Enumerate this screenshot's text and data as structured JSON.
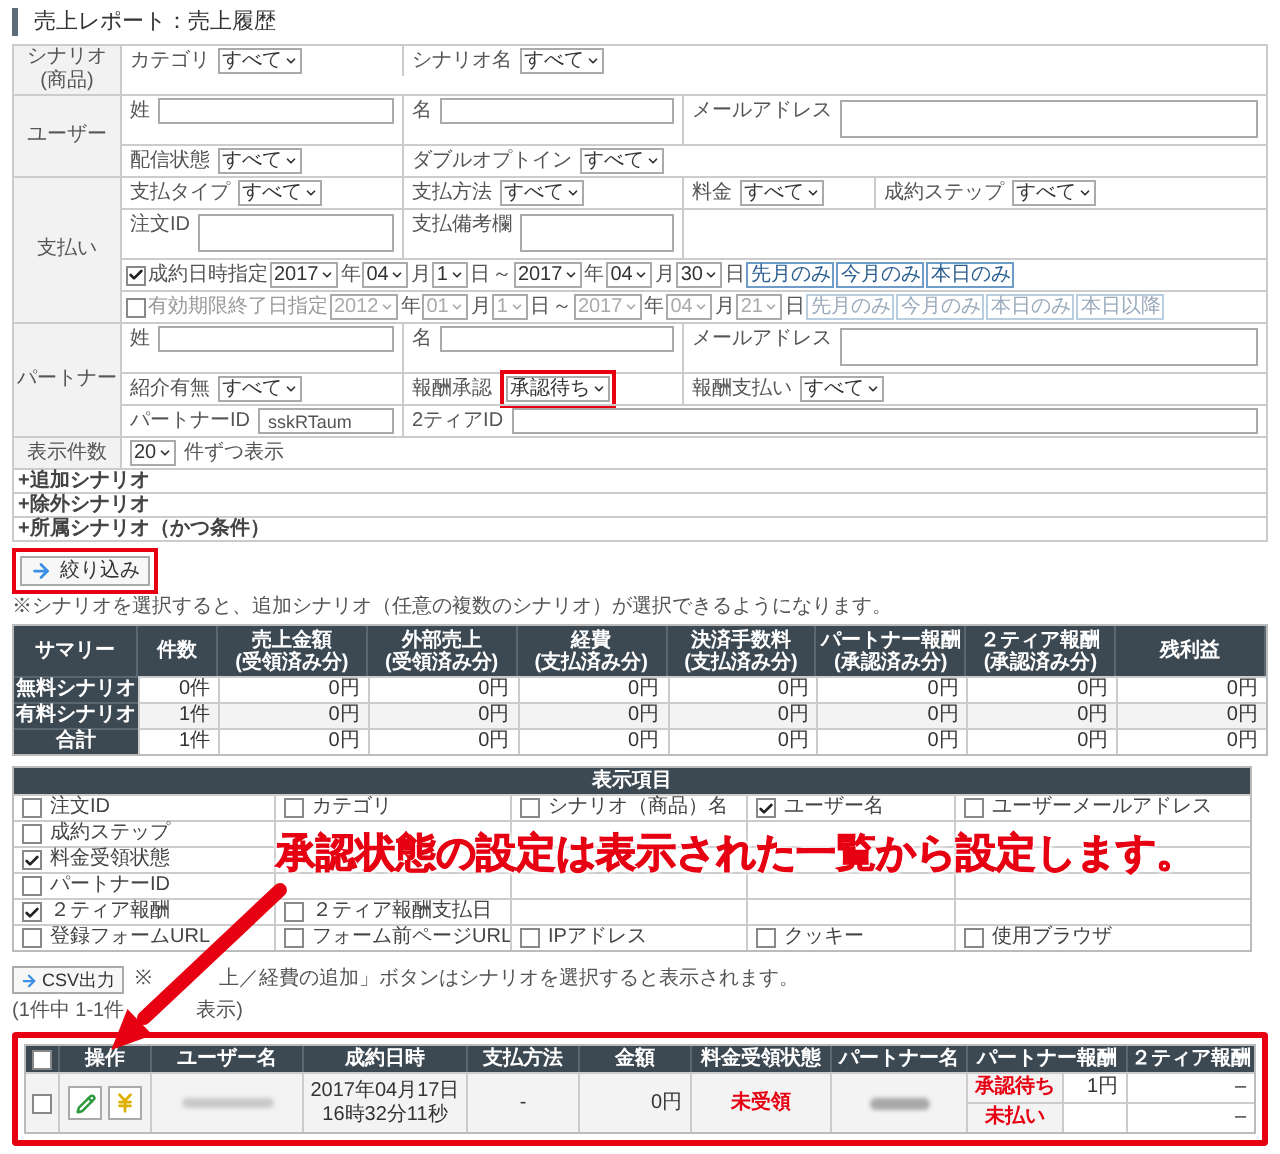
{
  "title": "売上レポート：売上履歴",
  "filter": {
    "sections": [
      {
        "label": [
          "シナリオ",
          "(商品)"
        ],
        "rows": [
          [
            {
              "kind": "select",
              "label": "カテゴリ",
              "value": "すべて"
            },
            {
              "kind": "select",
              "label": "シナリオ名",
              "value": "すべて"
            }
          ]
        ]
      },
      {
        "label": [
          "ユーザー"
        ],
        "rows": [
          [
            {
              "kind": "text",
              "label": "姓"
            },
            {
              "kind": "text",
              "label": "名"
            },
            {
              "kind": "textarea",
              "label": "メールアドレス"
            }
          ],
          [
            {
              "kind": "select",
              "label": "配信状態",
              "value": "すべて"
            },
            {
              "kind": "select",
              "label": "ダブルオプトイン",
              "value": "すべて"
            }
          ]
        ]
      },
      {
        "label": [
          "支払い"
        ],
        "rows": [
          [
            {
              "kind": "select",
              "label": "支払タイプ",
              "value": "すべて"
            },
            {
              "kind": "select",
              "label": "支払方法",
              "value": "すべて"
            },
            {
              "kind": "select",
              "label": "料金",
              "value": "すべて"
            },
            {
              "kind": "select",
              "label": "成約ステップ",
              "value": "すべて"
            }
          ],
          [
            {
              "kind": "textarea",
              "label": "注文ID"
            },
            {
              "kind": "textarea",
              "label": "支払備考欄"
            },
            {
              "kind": "empty"
            }
          ],
          [
            {
              "kind": "date_range",
              "checked": true,
              "label": "成約日時指定",
              "from": [
                {
                  "value": "2017",
                  "unit": "年"
                },
                {
                  "value": "04",
                  "unit": "月"
                },
                {
                  "value": "1",
                  "unit": "日"
                }
              ],
              "separator": "～",
              "to": [
                {
                  "value": "2017",
                  "unit": "年"
                },
                {
                  "value": "04",
                  "unit": "月"
                },
                {
                  "value": "30",
                  "unit": "日"
                }
              ],
              "buttons": [
                "先月のみ",
                "今月のみ",
                "本日のみ"
              ]
            }
          ],
          [
            {
              "kind": "date_range",
              "checked": false,
              "label": "有効期限終了日指定",
              "from": [
                {
                  "value": "2012",
                  "unit": "年"
                },
                {
                  "value": "01",
                  "unit": "月"
                },
                {
                  "value": "1",
                  "unit": "日"
                }
              ],
              "separator": "～",
              "to": [
                {
                  "value": "2017",
                  "unit": "年"
                },
                {
                  "value": "04",
                  "unit": "月"
                },
                {
                  "value": "21",
                  "unit": "日"
                }
              ],
              "buttons": [
                "先月のみ",
                "今月のみ",
                "本日のみ",
                "本日以降"
              ]
            }
          ]
        ]
      },
      {
        "label": [
          "パートナー"
        ],
        "rows": [
          [
            {
              "kind": "text",
              "label": "姓"
            },
            {
              "kind": "text",
              "label": "名"
            },
            {
              "kind": "textarea",
              "label": "メールアドレス"
            }
          ],
          [
            {
              "kind": "select",
              "label": "紹介有無",
              "value": "すべて"
            },
            {
              "kind": "select",
              "label": "報酬承認",
              "value": "承認待ち",
              "highlighted": true
            },
            {
              "kind": "select",
              "label": "報酬支払い",
              "value": "すべて"
            }
          ],
          [
            {
              "kind": "text",
              "label": "パートナーID",
              "value": "sskRTaum"
            },
            {
              "kind": "text",
              "label": "2ティアID"
            }
          ]
        ]
      },
      {
        "label": [
          "表示件数"
        ],
        "rows": [
          [
            {
              "kind": "select",
              "value": "20",
              "suffix": "件ずつ表示"
            }
          ]
        ]
      }
    ],
    "expanders": [
      "+追加シナリオ",
      "+除外シナリオ",
      "+所属シナリオ（かつ条件）"
    ]
  },
  "filter_button": {
    "label": "絞り込み",
    "highlighted": true
  },
  "filter_note": "※シナリオを選択すると、追加シナリオ（任意の複数のシナリオ）が選択できるようになります。",
  "summary": {
    "columns": [
      "サマリー",
      "件数",
      "売上金額\n(受領済み分)",
      "外部売上\n(受領済み分)",
      "経費\n(支払済み分)",
      "決済手数料\n(支払済み分)",
      "パートナー報酬\n(承認済み分)",
      "２ティア報酬\n(承認済み分)",
      "残利益"
    ],
    "rows": [
      {
        "cells": [
          "無料シナリオ",
          "0件",
          "0円",
          "0円",
          "0円",
          "0円",
          "0円",
          "0円",
          "0円"
        ]
      },
      {
        "cells": [
          "有料シナリオ",
          "1件",
          "0円",
          "0円",
          "0円",
          "0円",
          "0円",
          "0円",
          "0円"
        ]
      },
      {
        "cells": [
          "合計",
          "1件",
          "0円",
          "0円",
          "0円",
          "0円",
          "0円",
          "0円",
          "0円"
        ]
      }
    ]
  },
  "display_items": {
    "title": "表示項目",
    "rows": [
      [
        {
          "label": "注文ID",
          "checked": false
        },
        {
          "label": "カテゴリ",
          "checked": false
        },
        {
          "label": "シナリオ（商品）名",
          "checked": false
        },
        {
          "label": "ユーザー名",
          "checked": true
        },
        {
          "label": "ユーザーメールアドレス",
          "checked": false
        }
      ],
      [
        {
          "label": "成約ステップ",
          "checked": false
        }
      ],
      [
        {
          "label": "料金受領状態",
          "checked": true
        }
      ],
      [
        {
          "label": "パートナーID",
          "checked": false
        }
      ],
      [
        {
          "label": "２ティア報酬",
          "checked": true
        },
        {
          "label": "２ティア報酬支払日",
          "checked": false
        }
      ],
      [
        {
          "label": "登録フォームURL",
          "checked": false
        },
        {
          "label": "フォーム前ページURL",
          "checked": false
        },
        {
          "label": "IPアドレス",
          "checked": false
        },
        {
          "label": "クッキー",
          "checked": false
        },
        {
          "label": "使用ブラウザ",
          "checked": false
        }
      ]
    ]
  },
  "annotation": "承認状態の設定は表示された一覧から設定します。",
  "csv_button": "CSV出力",
  "csv_note_parts": [
    "※",
    "上／経費の追加」ボタンはシナリオを選択すると表示されます。"
  ],
  "count_parts": [
    "(1件中 1-1件",
    "表示)"
  ],
  "results": {
    "highlighted": true,
    "select_all_checked": false,
    "columns": [
      "操作",
      "ユーザー名",
      "成約日時",
      "支払方法",
      "金額",
      "料金受領状態",
      "パートナー名",
      "パートナー報酬",
      "２ティア報酬"
    ],
    "rows": [
      {
        "checked": false,
        "date_lines": [
          "2017年04月17日",
          "16時32分11秒"
        ],
        "payment_method": "-",
        "amount": "0円",
        "receipt_status": "未受領",
        "rewards": [
          {
            "status": "承認待ち",
            "amount": "1円",
            "tier2": "–"
          },
          {
            "status": "未払い",
            "tier2": "–"
          }
        ]
      }
    ]
  }
}
